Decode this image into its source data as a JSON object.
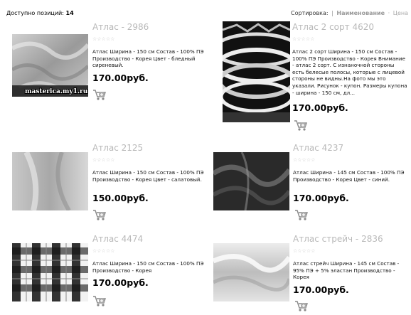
{
  "header": {
    "count_label": "Доступно позиций:",
    "count_value": "14",
    "sort_label": "Сортировка:",
    "sort_active": "Наименование",
    "sort_other": "Цена"
  },
  "products": [
    {
      "title": "Атлас - 2986",
      "stars": "☆☆☆☆☆",
      "desc": "Атлас Ширина - 150 см Состав - 100% ПЭ Производство - Корея Цвет - бледный сиреневый.",
      "price": "170.00руб.",
      "watermark": "masterica.my1.ru"
    },
    {
      "title": "Атлас 2 сорт 4620",
      "stars": "☆☆☆☆☆",
      "desc": "Атлас 2 сорт Ширина - 150 см Состав - 100% ПЭ Производство - Корея Внимание - атлас 2 сорт. С изнаночной стороны есть белесые полосы, которые с лицевой стороны не видны.На фото мы это указали. Рисунок - купон. Размеры купона - ширина - 150 см, дл...",
      "price": "170.00руб."
    },
    {
      "title": "Атлас 2125",
      "stars": "☆☆☆☆☆",
      "desc": "Атлас Ширина - 150 см Состав - 100% ПЭ Производство - Корея Цвет - салатовый.",
      "price": "150.00руб."
    },
    {
      "title": "Атлас 4237",
      "stars": "☆☆☆☆☆",
      "desc": "Атлас Ширина - 145 см Состав - 100% ПЭ Производство - Корея Цвет - синий.",
      "price": "170.00руб."
    },
    {
      "title": "Атлас 4474",
      "stars": "☆☆☆☆☆",
      "desc": "Атлас Ширина - 150 см Состав - 100% ПЭ Производство - Корея",
      "price": "170.00руб."
    },
    {
      "title": "Атлас стрейч - 2836",
      "stars": "☆☆☆☆☆",
      "desc": "Атлас стрейч Ширина - 145 см Состав - 95% ПЭ + 5% эластан Производство - Корея",
      "price": "170.00руб."
    }
  ]
}
